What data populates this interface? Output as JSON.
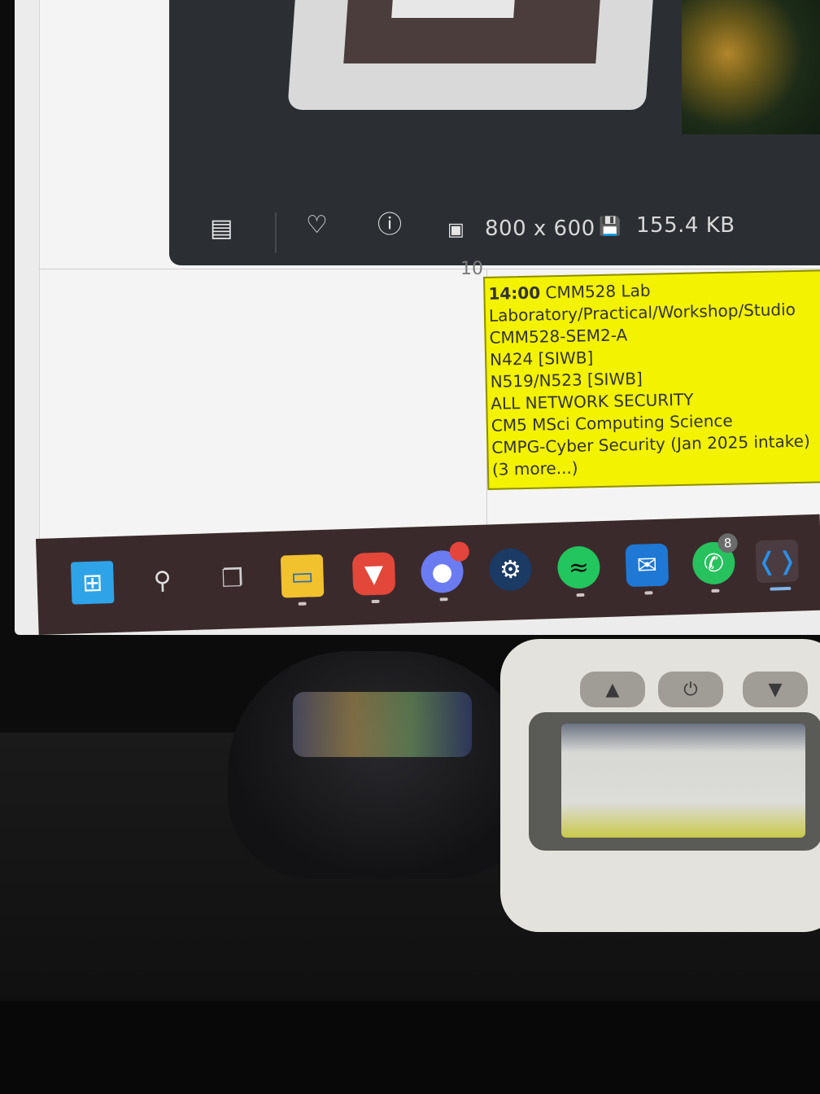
{
  "viewer": {
    "dimensions": "800 x 600",
    "file_size": "155.4 KB"
  },
  "calendar": {
    "day_number": "10",
    "event": {
      "time": "14:00",
      "title": "CMM528 Lab",
      "lines": [
        "Laboratory/Practical/Workshop/Studio",
        "CMM528-SEM2-A",
        "N424 [SIWB]",
        "N519/N523 [SIWB]",
        "ALL NETWORK SECURITY",
        "CM5 MSci Computing Science",
        "CMPG-Cyber Security (Jan 2025 intake)",
        "(3 more...)"
      ],
      "color": "#f3f200"
    }
  },
  "taskbar": {
    "whatsapp_badge": "8",
    "accent": "#3b2a2c"
  }
}
